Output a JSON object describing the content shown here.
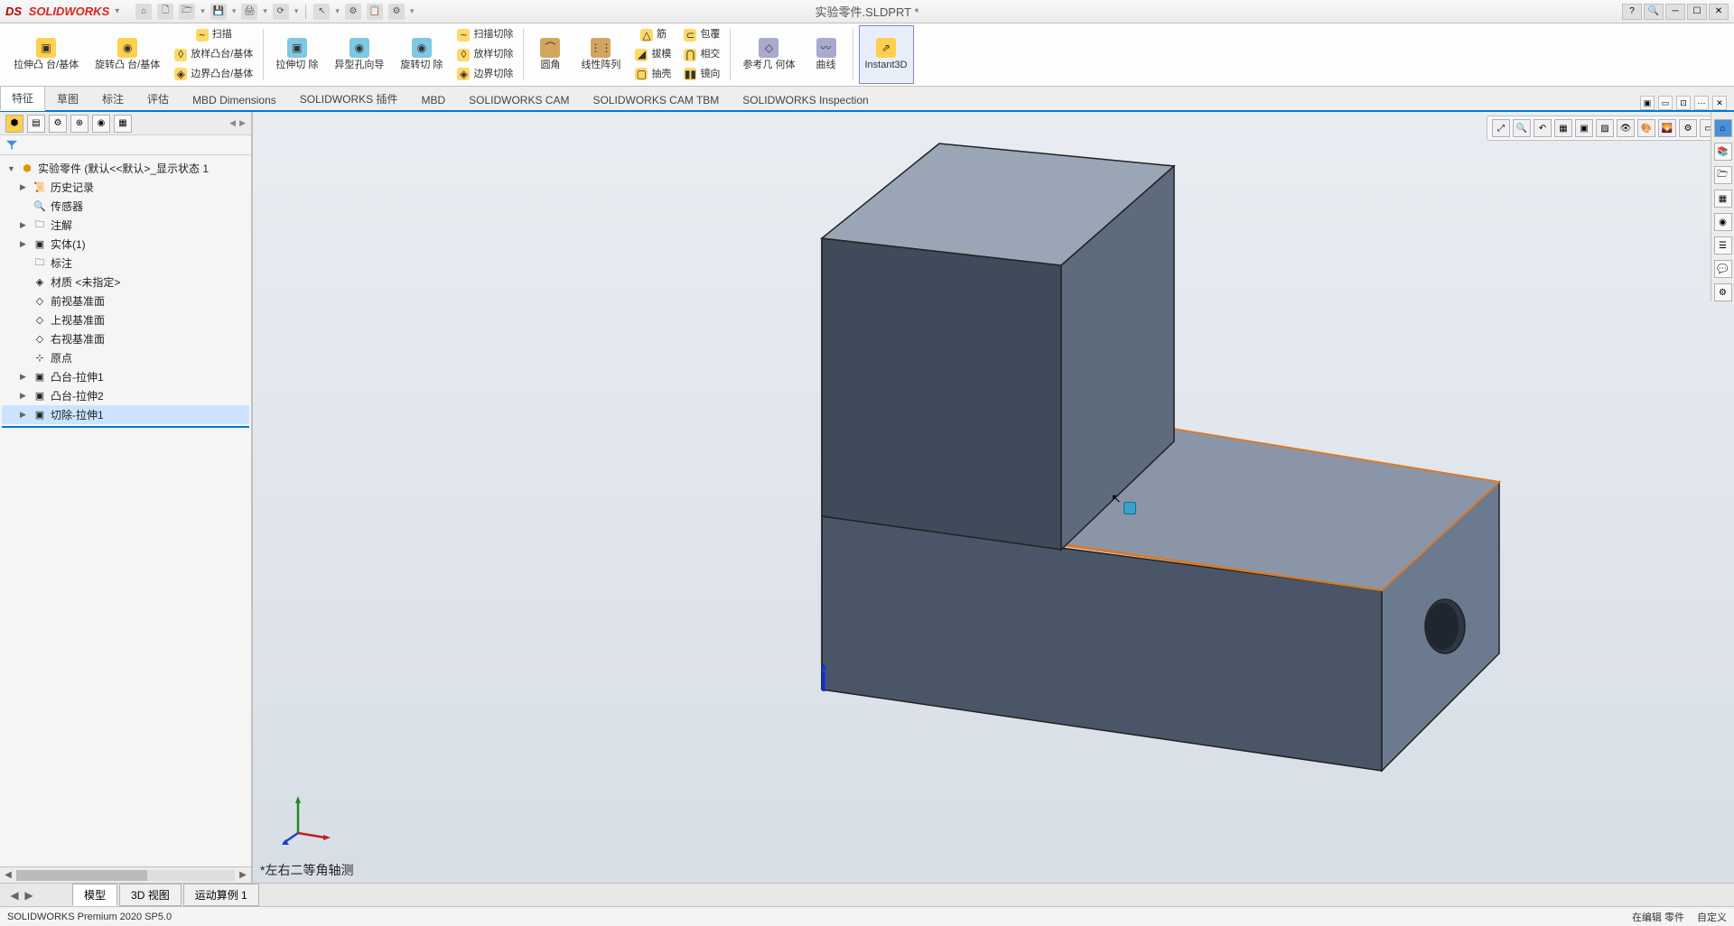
{
  "app": {
    "name": "SOLIDWORKS",
    "doc_title": "实验零件.SLDPRT *"
  },
  "ribbon": {
    "boss_extrude": "拉伸凸\n台/基体",
    "revolve_boss": "旋转凸\n台/基体",
    "sweep": "扫描",
    "loft_boss": "放样凸台/基体",
    "boundary_boss": "边界凸台/基体",
    "cut_extrude": "拉伸切\n除",
    "hole_wizard": "异型孔向导",
    "revolve_cut": "旋转切\n除",
    "sweep_cut": "扫描切除",
    "loft_cut": "放样切除",
    "boundary_cut": "边界切除",
    "fillet": "圆角",
    "pattern": "线性阵列",
    "rib": "筋",
    "draft": "拔模",
    "shell": "抽壳",
    "wrap": "包覆",
    "intersect": "相交",
    "mirror": "镜向",
    "refgeo": "参考几\n何体",
    "curves": "曲线",
    "instant3d": "Instant3D"
  },
  "tabs": [
    "特征",
    "草图",
    "标注",
    "评估",
    "MBD Dimensions",
    "SOLIDWORKS 插件",
    "MBD",
    "SOLIDWORKS CAM",
    "SOLIDWORKS CAM TBM",
    "SOLIDWORKS Inspection"
  ],
  "tree": {
    "root": "实验零件 (默认<<默认>_显示状态 1",
    "items": [
      {
        "icon": "📜",
        "label": "历史记录",
        "exp": "▶"
      },
      {
        "icon": "🔍",
        "label": "传感器"
      },
      {
        "icon": "🗀",
        "label": "注解",
        "exp": "▶"
      },
      {
        "icon": "▣",
        "label": "实体(1)",
        "exp": "▶"
      },
      {
        "icon": "🗀",
        "label": "标注"
      },
      {
        "icon": "◈",
        "label": "材质 <未指定>"
      },
      {
        "icon": "◇",
        "label": "前视基准面"
      },
      {
        "icon": "◇",
        "label": "上视基准面"
      },
      {
        "icon": "◇",
        "label": "右视基准面"
      },
      {
        "icon": "⊹",
        "label": "原点"
      },
      {
        "icon": "▣",
        "label": "凸台-拉伸1",
        "exp": "▶"
      },
      {
        "icon": "▣",
        "label": "凸台-拉伸2",
        "exp": "▶"
      },
      {
        "icon": "▣",
        "label": "切除-拉伸1",
        "exp": "▶",
        "sel": true
      }
    ]
  },
  "view_label": "*左右二等角轴测",
  "bottom_tabs": [
    "模型",
    "3D 视图",
    "运动算例 1"
  ],
  "status": {
    "left": "SOLIDWORKS Premium 2020 SP5.0",
    "right1": "在编辑 零件",
    "right2": "自定义"
  }
}
